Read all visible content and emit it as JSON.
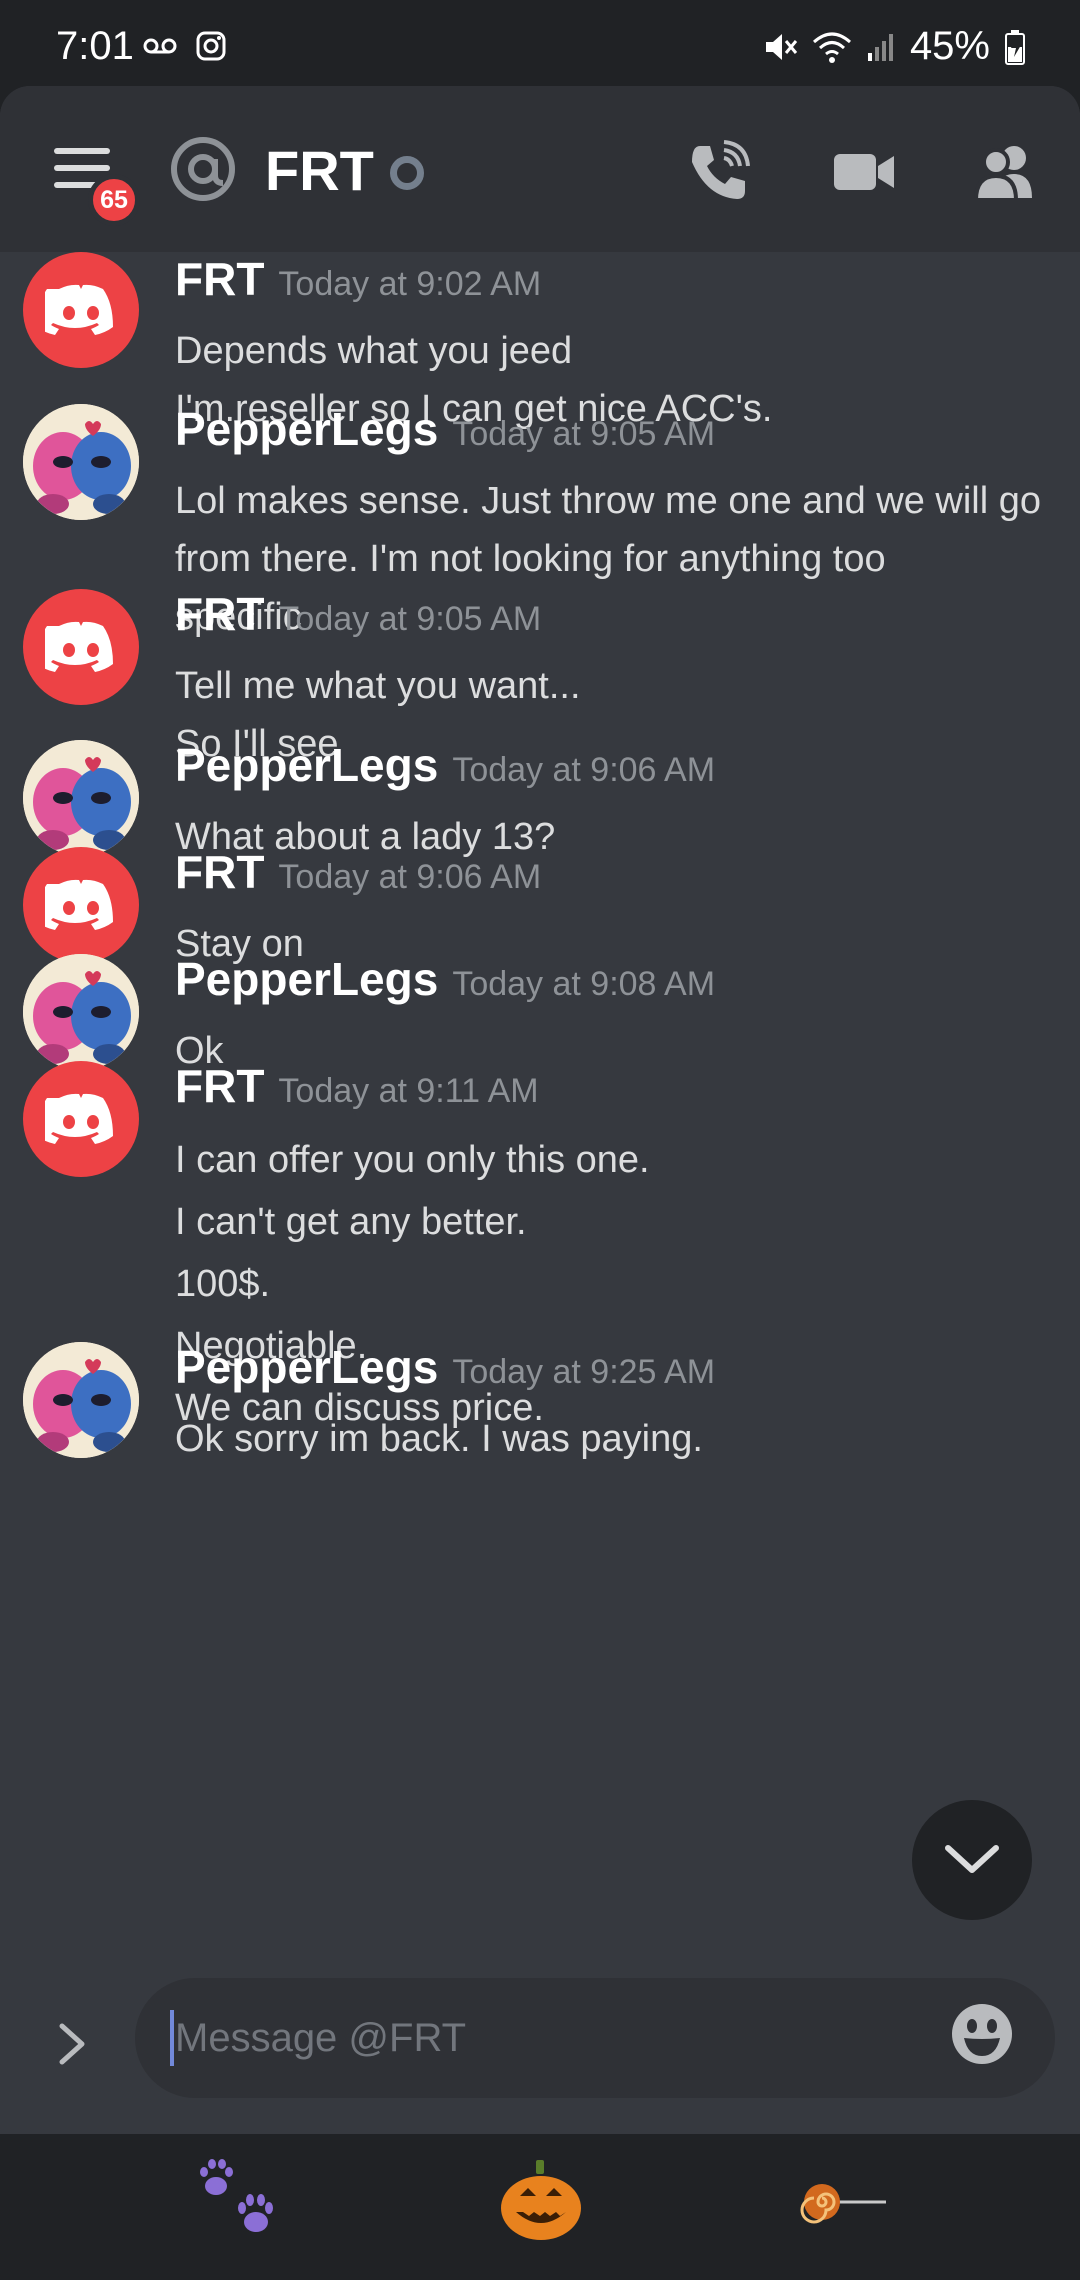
{
  "status_bar": {
    "time": "7:01",
    "battery": "45%",
    "left_icons": [
      "voicemail-icon",
      "instagram-icon"
    ],
    "right_icons": [
      "mute-icon",
      "wifi-icon",
      "signal-icon",
      "battery-charging-icon"
    ]
  },
  "header": {
    "unread_badge": "65",
    "title": "FRT",
    "icons": [
      "menu-icon",
      "at-icon",
      "status-dot",
      "call-icon",
      "video-icon",
      "members-icon"
    ]
  },
  "messages": [
    {
      "author": "FRT",
      "timestamp": "Today at 9:02 AM",
      "avatar": "discord",
      "lines": [
        "Depends what you jeed",
        "I'm.reseller so I can get nice ACC's."
      ]
    },
    {
      "author": "PepperLegs",
      "timestamp": "Today at 9:05 AM",
      "avatar": "pepper",
      "lines": [
        "Lol makes sense. Just throw me one and we will go",
        "from there. I'm not looking for anything too",
        "specific"
      ]
    },
    {
      "author": "FRT",
      "timestamp": "Today at 9:05 AM",
      "avatar": "discord",
      "lines": [
        "Tell me what you want...",
        "So I'll see"
      ]
    },
    {
      "author": "PepperLegs",
      "timestamp": "Today at 9:06 AM",
      "avatar": "pepper",
      "lines": [
        "What about a lady 13?"
      ]
    },
    {
      "author": "FRT",
      "timestamp": "Today at 9:06 AM",
      "avatar": "discord",
      "lines": [
        "Stay on"
      ]
    },
    {
      "author": "PepperLegs",
      "timestamp": "Today at 9:08 AM",
      "avatar": "pepper",
      "lines": [
        "Ok"
      ]
    },
    {
      "author": "FRT",
      "timestamp": "Today at 9:11 AM",
      "avatar": "discord",
      "lines": [
        "I can offer you only this one.",
        "I can't get any better.",
        "100$.",
        "Negotiable.",
        "We can discuss price."
      ]
    },
    {
      "author": "PepperLegs",
      "timestamp": "Today at 9:25 AM",
      "avatar": "pepper",
      "lines": [
        "Ok sorry im back. I was paying."
      ]
    }
  ],
  "composer": {
    "placeholder": "Message @FRT",
    "value": ""
  },
  "bottom_bar": {
    "items": [
      "paw-prints-icon",
      "jack-o-lantern-icon",
      "lollipop-icon"
    ]
  },
  "colors": {
    "background": "#36393f",
    "header": "#2f3136",
    "status_bar": "#202225",
    "brand_red": "#ed4245",
    "text": "#dcddde",
    "muted": "#8e9297"
  }
}
